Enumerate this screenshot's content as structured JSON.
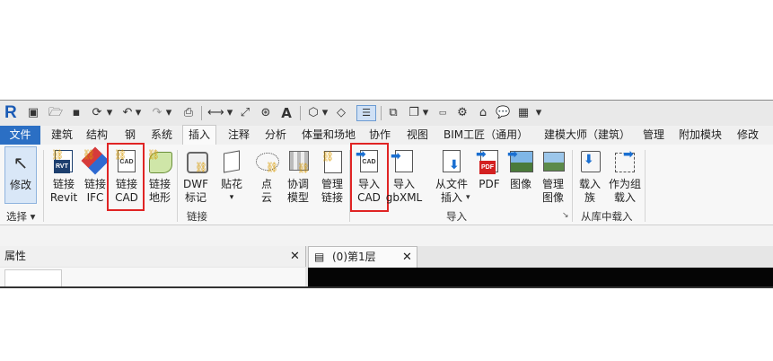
{
  "qat": {
    "dropdown_glyph": "▾"
  },
  "tabs": [
    {
      "label": "文件"
    },
    {
      "label": "建筑"
    },
    {
      "label": "结构"
    },
    {
      "label": "钢"
    },
    {
      "label": "系统"
    },
    {
      "label": "插入"
    },
    {
      "label": "注释"
    },
    {
      "label": "分析"
    },
    {
      "label": "体量和场地"
    },
    {
      "label": "协作"
    },
    {
      "label": "视图"
    },
    {
      "label": "BIM工匠（通用）"
    },
    {
      "label": "建模大师（建筑）"
    },
    {
      "label": "管理"
    },
    {
      "label": "附加模块"
    },
    {
      "label": "修改"
    }
  ],
  "ribbon": {
    "modify": {
      "l1": "修改",
      "group": "选择",
      "group_arrow": "▾"
    },
    "link_revit": {
      "l1": "链接",
      "l2": "Revit",
      "badge": "RVT"
    },
    "link_ifc": {
      "l1": "链接",
      "l2": "IFC"
    },
    "link_cad": {
      "l1": "链接",
      "l2": "CAD",
      "icon_text": "CAD"
    },
    "link_topo": {
      "l1": "链接",
      "l2": "地形"
    },
    "dwf": {
      "l1": "DWF",
      "l2": "标记"
    },
    "decal": {
      "l1": "贴花"
    },
    "pointcloud": {
      "l1": "点",
      "l2": "云"
    },
    "coord": {
      "l1": "协调",
      "l2": "模型"
    },
    "manage_links": {
      "l1": "管理",
      "l2": "链接"
    },
    "import_cad": {
      "l1": "导入",
      "l2": "CAD",
      "icon_text": "CAD"
    },
    "import_gbxml": {
      "l1": "导入",
      "l2": "gbXML"
    },
    "from_file": {
      "l1": "从文件",
      "l2": "插入"
    },
    "pdf": {
      "l1": "PDF",
      "badge": "PDF"
    },
    "image": {
      "l1": "图像"
    },
    "manage_images": {
      "l1": "管理",
      "l2": "图像"
    },
    "load_family": {
      "l1": "载入",
      "l2": "族"
    },
    "as_group": {
      "l1": "作为组",
      "l2": "载入"
    },
    "groups": {
      "link": "链接",
      "import": "导入",
      "library": "从库中载入"
    }
  },
  "panels": {
    "properties_title": "属性",
    "close_glyph": "✕",
    "view_tab": "(0)第1层"
  }
}
